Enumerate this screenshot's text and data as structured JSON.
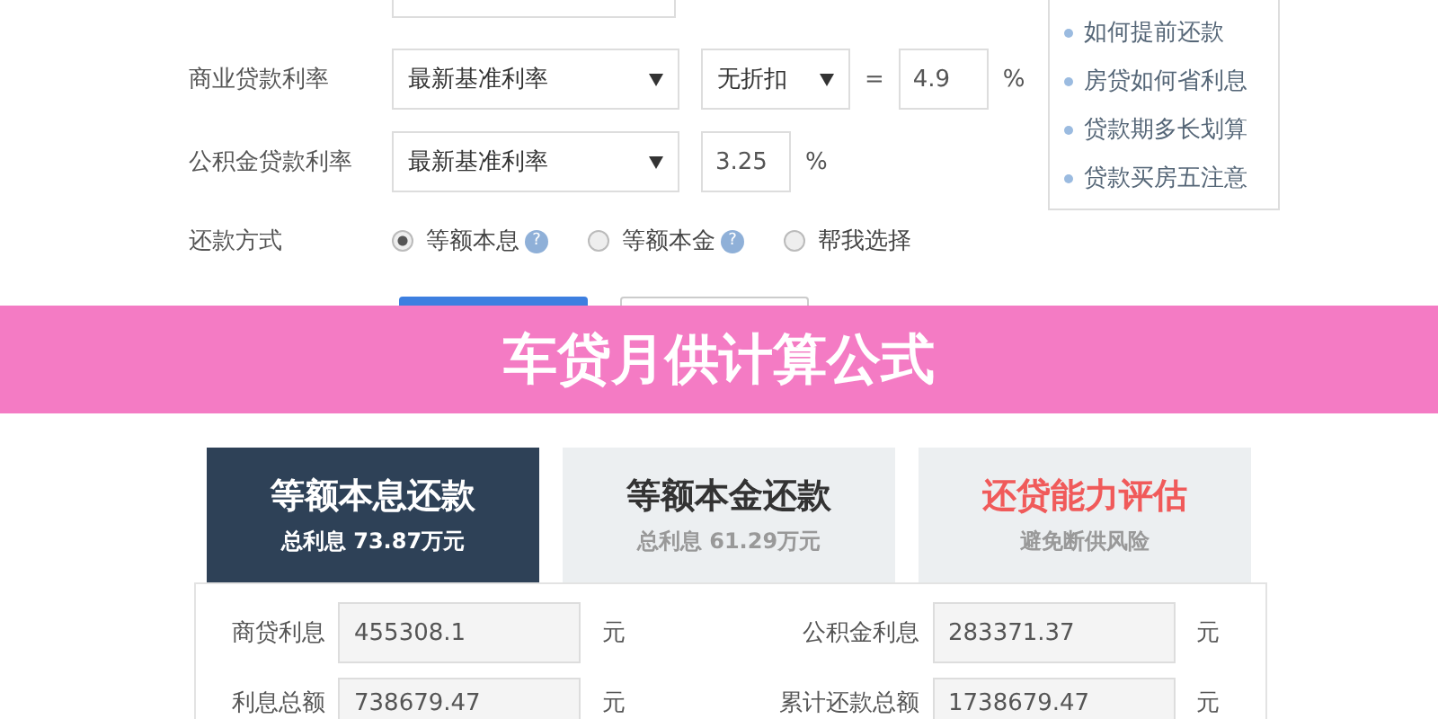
{
  "form": {
    "rows": [
      {
        "kind": "rate",
        "label": "商业贷款利率",
        "select": "最新基准利率",
        "discount": "无折扣",
        "equals": "=",
        "value": "4.9",
        "unit": "%"
      },
      {
        "kind": "fund",
        "label": "公积金贷款利率",
        "select": "最新基准利率",
        "value": "3.25",
        "unit": "%"
      }
    ],
    "method": {
      "label": "还款方式",
      "options": [
        {
          "label": "等额本息",
          "help": "?",
          "selected": true
        },
        {
          "label": "等额本金",
          "help": "?",
          "selected": false
        },
        {
          "label": "帮我选择",
          "selected": false
        }
      ]
    },
    "buttons": [
      {
        "kind": "primary"
      },
      {
        "kind": "secondary"
      }
    ]
  },
  "sidebar": {
    "items": [
      "如何提前还款",
      "房贷如何省利息",
      "贷款期多长划算",
      "贷款买房五注意"
    ]
  },
  "banner": {
    "title": "车贷月供计算公式"
  },
  "tabs": [
    {
      "kind": "result",
      "title": "等额本息还款",
      "subtitle": "总利息 73.87万元",
      "selected": true
    },
    {
      "kind": "result",
      "title": "等额本金还款",
      "subtitle": "总利息 61.29万元",
      "selected": false
    },
    {
      "kind": "assessment",
      "title": "还贷能力评估",
      "subtitle": "避免断供风险",
      "selected": false
    }
  ],
  "results": [
    {
      "label": "商贷利息",
      "value": "455308.1",
      "unit": "元"
    },
    {
      "label": "公积金利息",
      "value": "283371.37",
      "unit": "元"
    },
    {
      "label": "利息总额",
      "value": "738679.47",
      "unit": "元"
    },
    {
      "label": "累计还款总额",
      "value": "1738679.47",
      "unit": "元"
    }
  ]
}
